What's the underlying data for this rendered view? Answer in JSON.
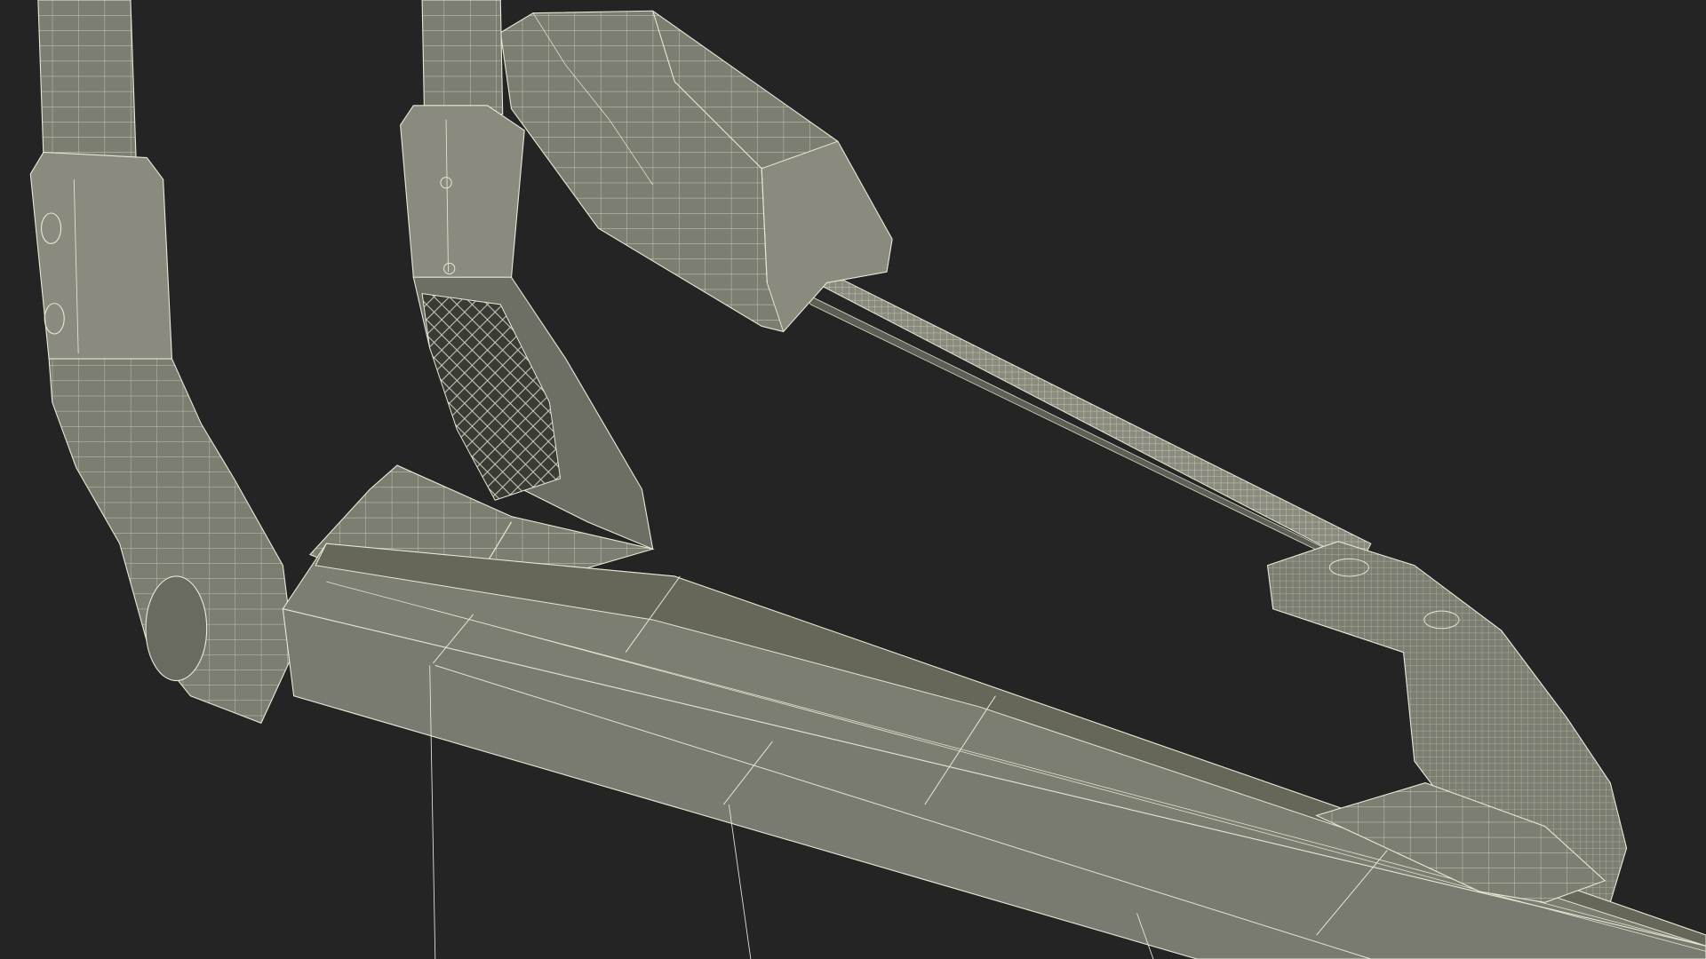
{
  "scene": {
    "subject": "wireframe-3d-render",
    "background_color": "#242424",
    "colors": {
      "body": "#7d7e72",
      "body_light": "#8a8b7e",
      "body_dark": "#5f6055",
      "body_shadow": "#4e4f46",
      "wire": "#e8e8d6"
    }
  }
}
